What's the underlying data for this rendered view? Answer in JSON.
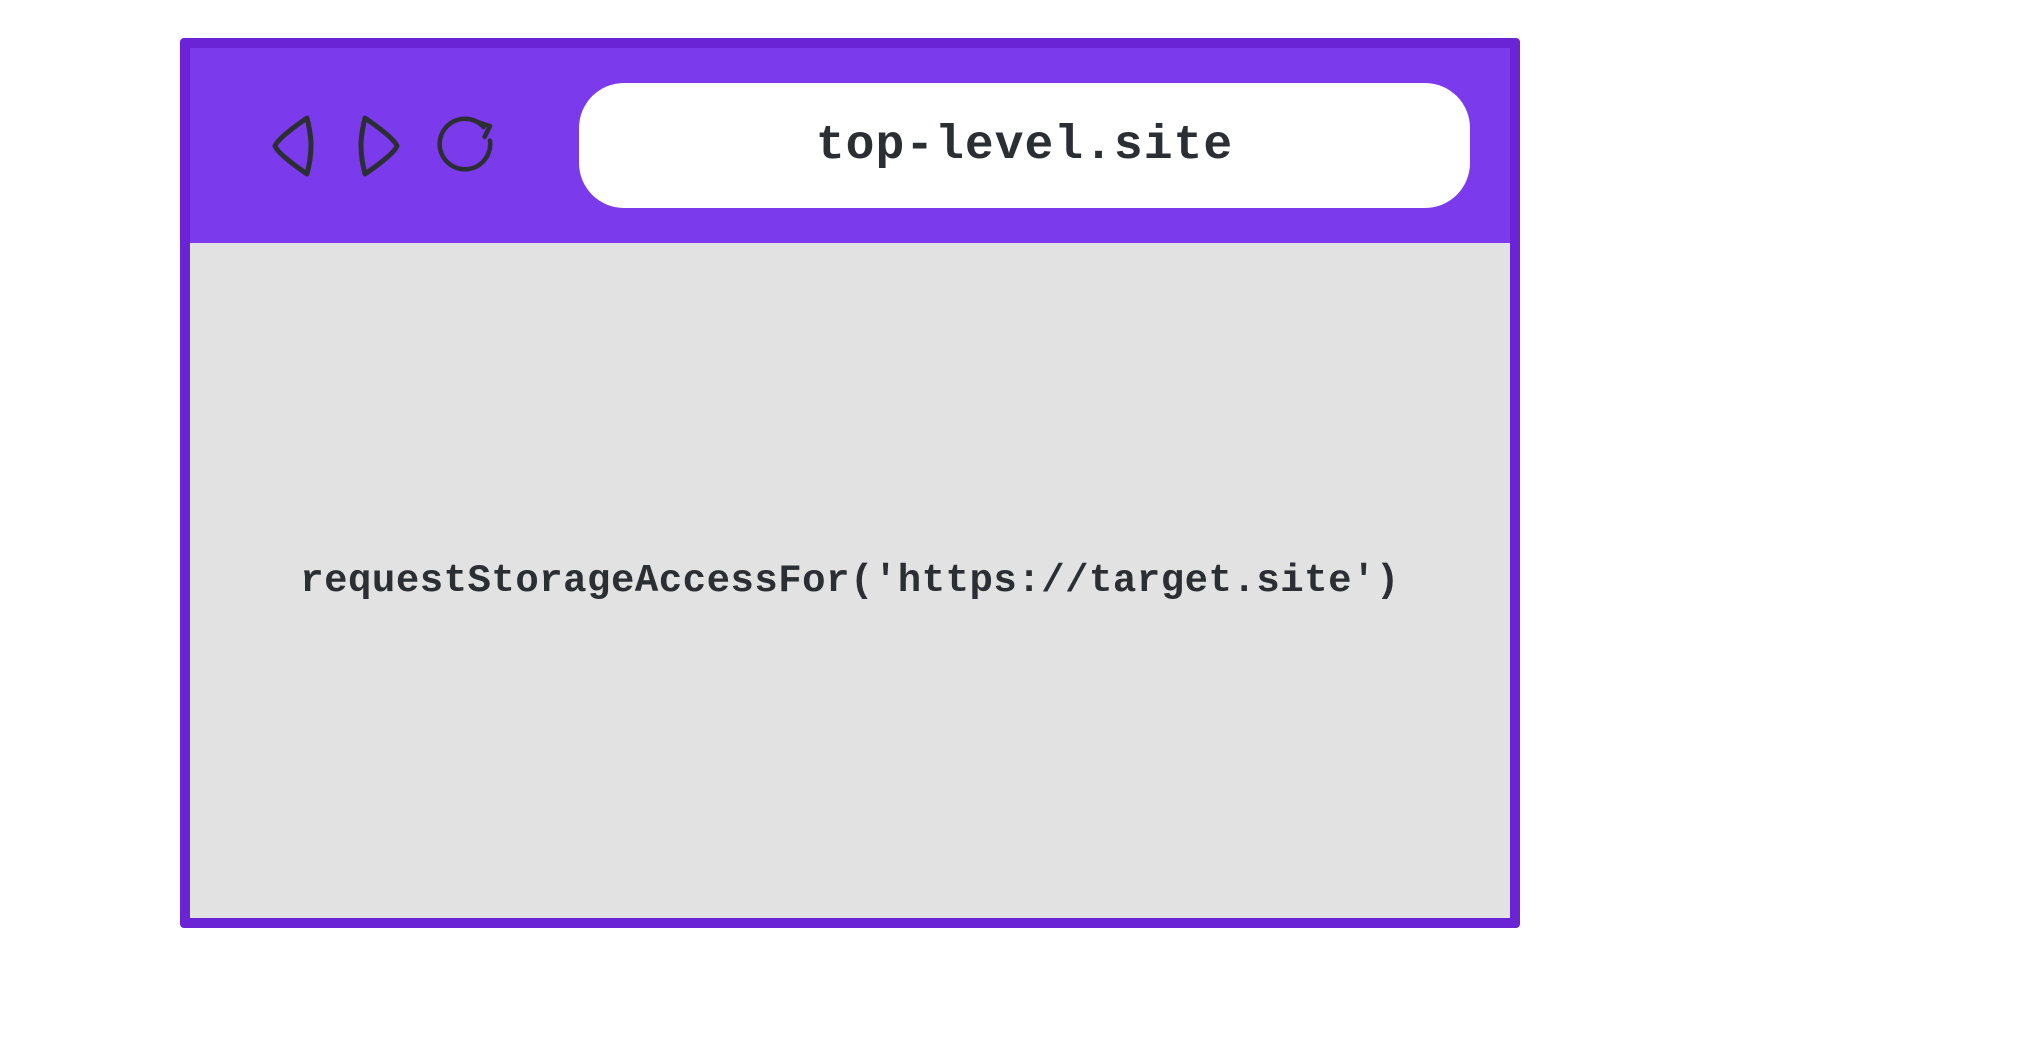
{
  "browser": {
    "address": "top-level.site"
  },
  "content": {
    "code": "requestStorageAccessFor('https://target.site')"
  },
  "colors": {
    "toolbar_bg": "#7c3aed",
    "border": "#6a24d6",
    "content_bg": "#e2e2e2",
    "text": "#2b2f33"
  }
}
